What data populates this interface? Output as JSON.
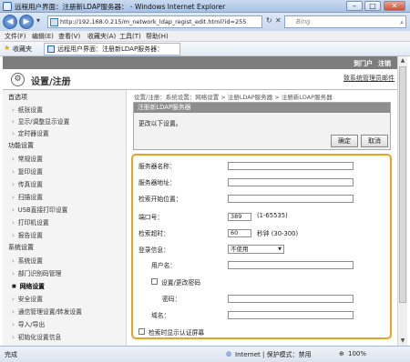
{
  "window": {
    "title": "远程用户界面：注册新LDAP服务器： - Windows Internet Explorer",
    "min": "–",
    "max": "□",
    "close": "✕"
  },
  "nav": {
    "back": "◀",
    "forward": "▶",
    "url": "http://192.168.0.215/m_network_ldap_regist_edit.html?id=255",
    "refresh": "↻",
    "stop": "✕",
    "search_placeholder": "Bing",
    "search_icon": "⌕"
  },
  "menu": [
    "文件(F)",
    "编辑(E)",
    "查看(V)",
    "收藏夹(A)",
    "工具(T)",
    "帮助(H)"
  ],
  "fav": {
    "label": "收藏夹",
    "tab": "远程用户界面：注册新LDAP服务器："
  },
  "top": {
    "portal": "到门户",
    "logout": "注销"
  },
  "header": {
    "logo": "⚙",
    "title": "设置/注册",
    "mail": "致系统管理员邮件"
  },
  "sidebar": {
    "sec1": "首选项",
    "pref": [
      "纸张设置",
      "显示/调整显示设置",
      "定时器设置"
    ],
    "sec2": "功能设置",
    "func": [
      "常规设置",
      "复印设置",
      "传真设置",
      "扫描设置",
      "USB直接打印设置",
      "打印机设置",
      "报告设置"
    ],
    "sec3": "系统设置",
    "sys": [
      "系统设置",
      "部门识别码管理",
      "网络设置",
      "安全设置",
      "通信管理设置/转发设置",
      "导入/导出",
      "初始化设置信息"
    ]
  },
  "breadcrumb": "设置/注册：系统设置：网络设置 > 注册LDAP服务器 > 注册新LDAP服务器",
  "dialog": {
    "title": "注册新LDAP服务器",
    "message": "更改以下设置。",
    "ok": "确定",
    "cancel": "取消"
  },
  "form": {
    "server_name": "服务器名称：",
    "server_addr": "服务器地址：",
    "search_start": "检索开始位置：",
    "port": "端口号：",
    "port_value": "389",
    "port_range": "(1-65535)",
    "timeout": "检索超时：",
    "timeout_value": "60",
    "timeout_range": "秒钟 (30-300)",
    "login": "登录信息：",
    "login_value": "不使用",
    "username": "用户名：",
    "set_password": "设置/更改密码",
    "password": "密码：",
    "domain": "域名：",
    "show_auth": "检索时显示认证屏幕"
  },
  "status": {
    "done": "完成",
    "zone": "Internet | 保护模式：禁用",
    "zoom": "100%"
  }
}
